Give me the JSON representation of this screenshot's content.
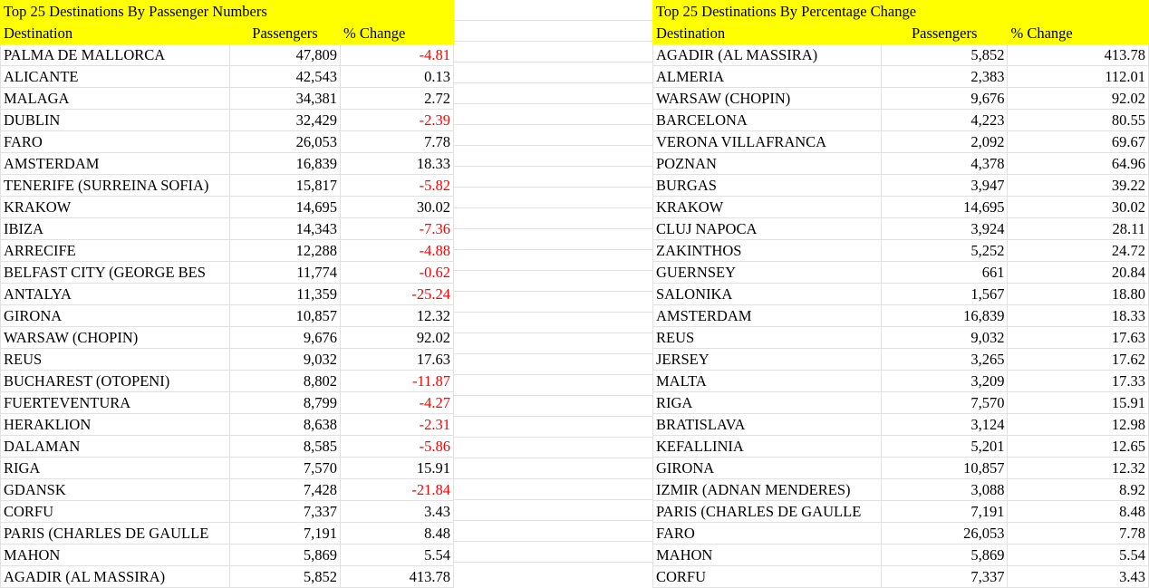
{
  "left_table": {
    "title": "Top 25 Destinations By Passenger Numbers",
    "headers": [
      "Destination",
      "Passengers",
      "% Change"
    ],
    "rows": [
      [
        "PALMA DE MALLORCA",
        "47,809",
        "-4.81"
      ],
      [
        "ALICANTE",
        "42,543",
        "0.13"
      ],
      [
        "MALAGA",
        "34,381",
        "2.72"
      ],
      [
        "DUBLIN",
        "32,429",
        "-2.39"
      ],
      [
        "FARO",
        "26,053",
        "7.78"
      ],
      [
        "AMSTERDAM",
        "16,839",
        "18.33"
      ],
      [
        "TENERIFE (SURREINA SOFIA)",
        "15,817",
        "-5.82"
      ],
      [
        "KRAKOW",
        "14,695",
        "30.02"
      ],
      [
        "IBIZA",
        "14,343",
        "-7.36"
      ],
      [
        "ARRECIFE",
        "12,288",
        "-4.88"
      ],
      [
        "BELFAST CITY (GEORGE BES",
        "11,774",
        "-0.62"
      ],
      [
        "ANTALYA",
        "11,359",
        "-25.24"
      ],
      [
        "GIRONA",
        "10,857",
        "12.32"
      ],
      [
        "WARSAW (CHOPIN)",
        "9,676",
        "92.02"
      ],
      [
        "REUS",
        "9,032",
        "17.63"
      ],
      [
        "BUCHAREST (OTOPENI)",
        "8,802",
        "-11.87"
      ],
      [
        "FUERTEVENTURA",
        "8,799",
        "-4.27"
      ],
      [
        "HERAKLION",
        "8,638",
        "-2.31"
      ],
      [
        "DALAMAN",
        "8,585",
        "-5.86"
      ],
      [
        "RIGA",
        "7,570",
        "15.91"
      ],
      [
        "GDANSK",
        "7,428",
        "-21.84"
      ],
      [
        "CORFU",
        "7,337",
        "3.43"
      ],
      [
        "PARIS (CHARLES DE GAULLE",
        "7,191",
        "8.48"
      ],
      [
        "MAHON",
        "5,869",
        "5.54"
      ],
      [
        "AGADIR (AL MASSIRA)",
        "5,852",
        "413.78"
      ]
    ]
  },
  "right_table": {
    "title": "Top 25 Destinations By Percentage Change",
    "headers": [
      "Destination",
      "Passengers",
      "% Change"
    ],
    "rows": [
      [
        "AGADIR (AL MASSIRA)",
        "5,852",
        "413.78"
      ],
      [
        "ALMERIA",
        "2,383",
        "112.01"
      ],
      [
        "WARSAW (CHOPIN)",
        "9,676",
        "92.02"
      ],
      [
        "BARCELONA",
        "4,223",
        "80.55"
      ],
      [
        "VERONA VILLAFRANCA",
        "2,092",
        "69.67"
      ],
      [
        "POZNAN",
        "4,378",
        "64.96"
      ],
      [
        "BURGAS",
        "3,947",
        "39.22"
      ],
      [
        "KRAKOW",
        "14,695",
        "30.02"
      ],
      [
        "CLUJ NAPOCA",
        "3,924",
        "28.11"
      ],
      [
        "ZAKINTHOS",
        "5,252",
        "24.72"
      ],
      [
        "GUERNSEY",
        "661",
        "20.84"
      ],
      [
        "SALONIKA",
        "1,567",
        "18.80"
      ],
      [
        "AMSTERDAM",
        "16,839",
        "18.33"
      ],
      [
        "REUS",
        "9,032",
        "17.63"
      ],
      [
        "JERSEY",
        "3,265",
        "17.62"
      ],
      [
        "MALTA",
        "3,209",
        "17.33"
      ],
      [
        "RIGA",
        "7,570",
        "15.91"
      ],
      [
        "BRATISLAVA",
        "3,124",
        "12.98"
      ],
      [
        "KEFALLINIA",
        "5,201",
        "12.65"
      ],
      [
        "GIRONA",
        "10,857",
        "12.32"
      ],
      [
        "IZMIR (ADNAN MENDERES)",
        "3,088",
        "8.92"
      ],
      [
        "PARIS (CHARLES DE GAULLE",
        "7,191",
        "8.48"
      ],
      [
        "FARO",
        "26,053",
        "7.78"
      ],
      [
        "MAHON",
        "5,869",
        "5.54"
      ],
      [
        "CORFU",
        "7,337",
        "3.43"
      ]
    ]
  },
  "colors": {
    "header_fill": "#ffff00",
    "negative": "#ff0000",
    "grid": "#e1e1e1"
  }
}
